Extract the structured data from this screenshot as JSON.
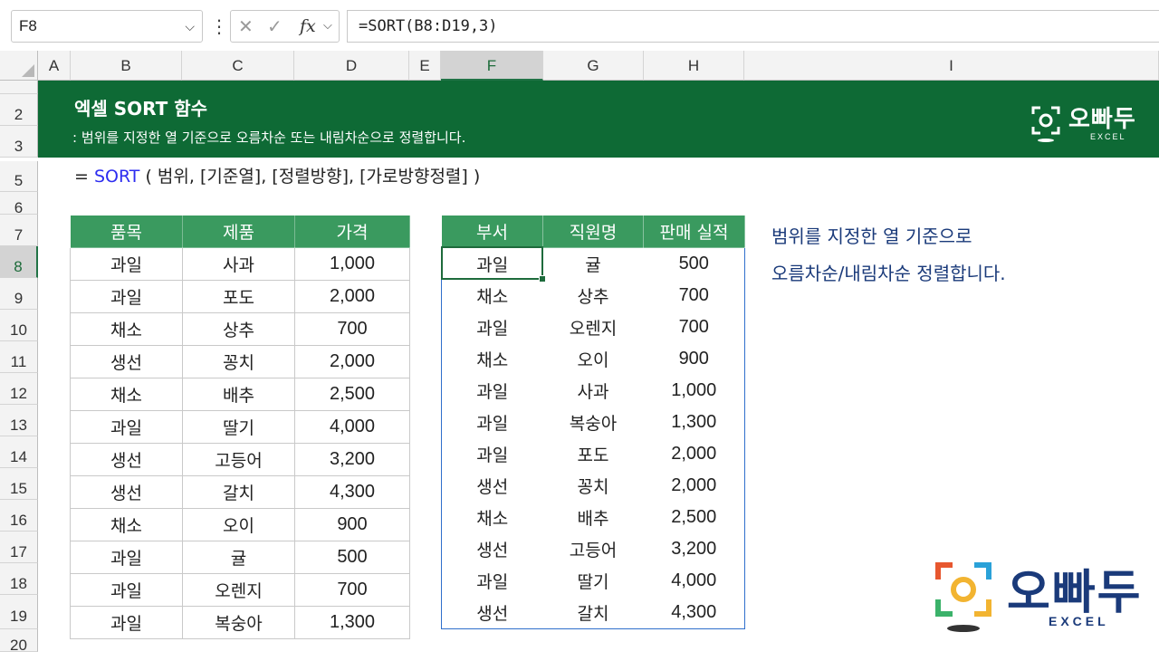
{
  "formula_bar": {
    "name_box": "F8",
    "cancel_icon": "✕",
    "enter_icon": "✓",
    "fx_label": "fx",
    "formula": "=SORT(B8:D19,3)"
  },
  "columns": [
    "A",
    "B",
    "C",
    "D",
    "E",
    "F",
    "G",
    "H",
    "I"
  ],
  "selected_column": "F",
  "rows": [
    "2",
    "3",
    "5",
    "6",
    "7",
    "8",
    "9",
    "10",
    "11",
    "12",
    "13",
    "14",
    "15",
    "16",
    "17",
    "18",
    "19",
    "20"
  ],
  "selected_row": "8",
  "banner": {
    "title": "엑셀 SORT 함수",
    "subtitle": ": 범위를 지정한 열 기준으로 오름차순 또는 내림차순으로 정렬합니다.",
    "logo": "오빠두",
    "logo_sub": "EXCEL"
  },
  "syntax": {
    "eq": "= ",
    "fn": "SORT",
    "args": " ( 범위, [기준열], [정렬방향], [가로방향정렬] )"
  },
  "source_table": {
    "headers": [
      "품목",
      "제품",
      "가격"
    ],
    "rows": [
      [
        "과일",
        "사과",
        "1,000"
      ],
      [
        "과일",
        "포도",
        "2,000"
      ],
      [
        "채소",
        "상추",
        "700"
      ],
      [
        "생선",
        "꽁치",
        "2,000"
      ],
      [
        "채소",
        "배추",
        "2,500"
      ],
      [
        "과일",
        "딸기",
        "4,000"
      ],
      [
        "생선",
        "고등어",
        "3,200"
      ],
      [
        "생선",
        "갈치",
        "4,300"
      ],
      [
        "채소",
        "오이",
        "900"
      ],
      [
        "과일",
        "귤",
        "500"
      ],
      [
        "과일",
        "오렌지",
        "700"
      ],
      [
        "과일",
        "복숭아",
        "1,300"
      ]
    ]
  },
  "result_table": {
    "headers": [
      "부서",
      "직원명",
      "판매 실적"
    ],
    "rows": [
      [
        "과일",
        "귤",
        "500"
      ],
      [
        "채소",
        "상추",
        "700"
      ],
      [
        "과일",
        "오렌지",
        "700"
      ],
      [
        "채소",
        "오이",
        "900"
      ],
      [
        "과일",
        "사과",
        "1,000"
      ],
      [
        "과일",
        "복숭아",
        "1,300"
      ],
      [
        "과일",
        "포도",
        "2,000"
      ],
      [
        "생선",
        "꽁치",
        "2,000"
      ],
      [
        "채소",
        "배추",
        "2,500"
      ],
      [
        "생선",
        "고등어",
        "3,200"
      ],
      [
        "과일",
        "딸기",
        "4,000"
      ],
      [
        "생선",
        "갈치",
        "4,300"
      ]
    ]
  },
  "note": {
    "line1": "범위를 지정한 열 기준으로",
    "line2": "오름차순/내림차순 정렬합니다."
  },
  "logo": {
    "text": "오빠두",
    "sub": "EXCEL"
  },
  "colors": {
    "banner": "#0e6a35",
    "header": "#3a9a5f",
    "accent_blue": "#2d2df0",
    "navy": "#1a3a7a"
  }
}
